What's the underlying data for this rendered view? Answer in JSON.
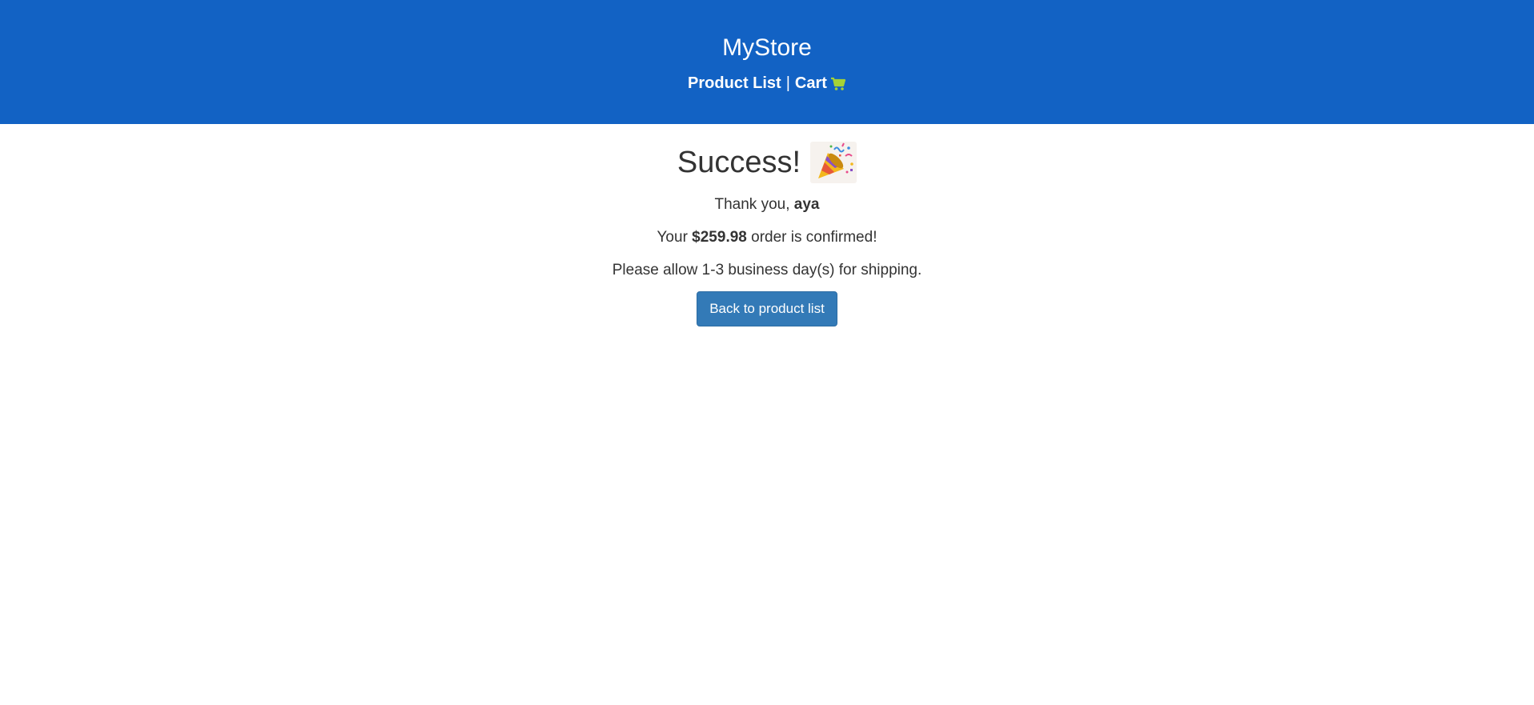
{
  "header": {
    "brand": "MyStore",
    "nav": {
      "product_list": "Product List",
      "separator": "|",
      "cart": "Cart",
      "cart_icon": "cart-icon"
    },
    "background_color": "#1262c4",
    "cart_icon_color": "#a5d235"
  },
  "main": {
    "title": "Success!",
    "title_icon": "party-popper-icon",
    "thank_prefix": "Thank you, ",
    "user_name": "aya",
    "order_prefix": "Your ",
    "order_amount": "$259.98",
    "order_suffix": " order is confirmed!",
    "shipping_text": "Please allow 1-3 business day(s) for shipping.",
    "back_button_label": "Back to product list",
    "button_color": "#337ab7"
  }
}
